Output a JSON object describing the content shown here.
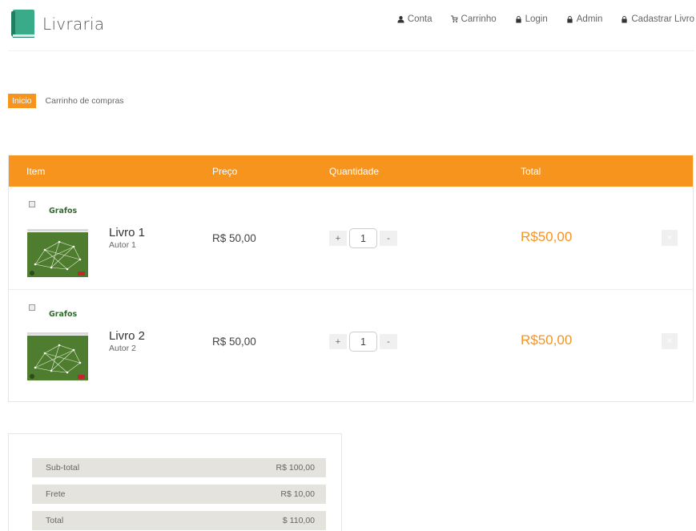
{
  "brand": {
    "name": "Livraria",
    "logo_icon": "book-icon"
  },
  "nav": [
    {
      "label": "Conta",
      "icon": "user-icon"
    },
    {
      "label": "Carrinho",
      "icon": "cart-icon"
    },
    {
      "label": "Login",
      "icon": "lock-icon"
    },
    {
      "label": "Admin",
      "icon": "lock-icon"
    },
    {
      "label": "Cadastrar Livro",
      "icon": "lock-icon"
    }
  ],
  "breadcrumb": {
    "home": "Inicio",
    "current": "Carrinho de compras"
  },
  "cart": {
    "headers": {
      "item": "Item",
      "price": "Preço",
      "quantity": "Quantidade",
      "total": "Total"
    },
    "items": [
      {
        "cover_title": "Grafos",
        "name": "Livro 1",
        "author": "Autor 1",
        "price": "R$ 50,00",
        "quantity": "1",
        "total": "R$50,00",
        "plus": "+",
        "minus": "-",
        "remove": "×"
      },
      {
        "cover_title": "Grafos",
        "name": "Livro 2",
        "author": "Autor 2",
        "price": "R$ 50,00",
        "quantity": "1",
        "total": "R$50,00",
        "plus": "+",
        "minus": "-",
        "remove": "×"
      }
    ]
  },
  "summary": {
    "subtotal_label": "Sub-total",
    "subtotal_value": "R$ 100,00",
    "shipping_label": "Frete",
    "shipping_value": "R$ 10,00",
    "total_label": "Total",
    "total_value": "$ 110,00"
  },
  "colors": {
    "accent": "#f7941d",
    "brand_green": "#3aab88",
    "summary_bg": "#e4e3de"
  }
}
